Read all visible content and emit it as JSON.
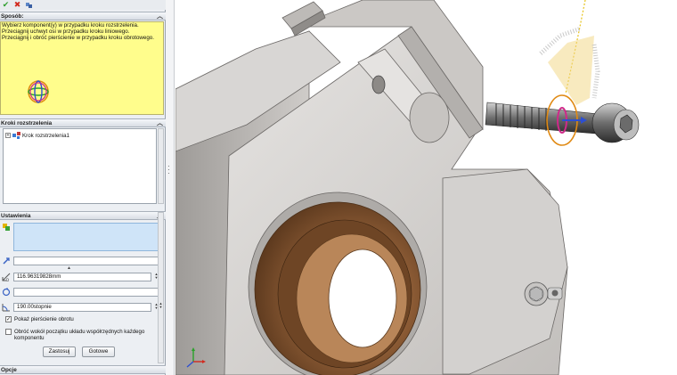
{
  "toolbar": {
    "ok_icon": "checkmark-icon",
    "cancel_icon": "x-icon",
    "pin_icon": "pin-icon"
  },
  "sposob": {
    "title": "Sposób:",
    "lines": [
      "Wybierz komponent(y) w przypadku kroku rozstrzelenia.",
      "Przeciągnij uchwyt osi w przypadku kroku liniowego.",
      "Przeciągnij i obróć pierścienie w przypadku kroku obrotowego."
    ]
  },
  "kroki": {
    "title": "Kroki rozstrzelenia",
    "item": "Krok rozstrzelenia1"
  },
  "ustawienia": {
    "title": "Ustawienia",
    "distance_value": "116.96319828mm",
    "angle_value": "190.00stopnie",
    "show_rings_label": "Pokaż pierścienie obrotu",
    "show_rings_checked": true,
    "rotate_origin_label": "Obróć wokół początku układu współrzędnych każdego komponentu",
    "rotate_origin_checked": false,
    "apply_button": "Zastosuj",
    "done_button": "Gotowe"
  },
  "opcje": {
    "title": "Opcje"
  },
  "model": {
    "bearing_color": "#8a5a34",
    "body_color": "#dddbd9",
    "ruler_color": "#f0cf7a"
  }
}
